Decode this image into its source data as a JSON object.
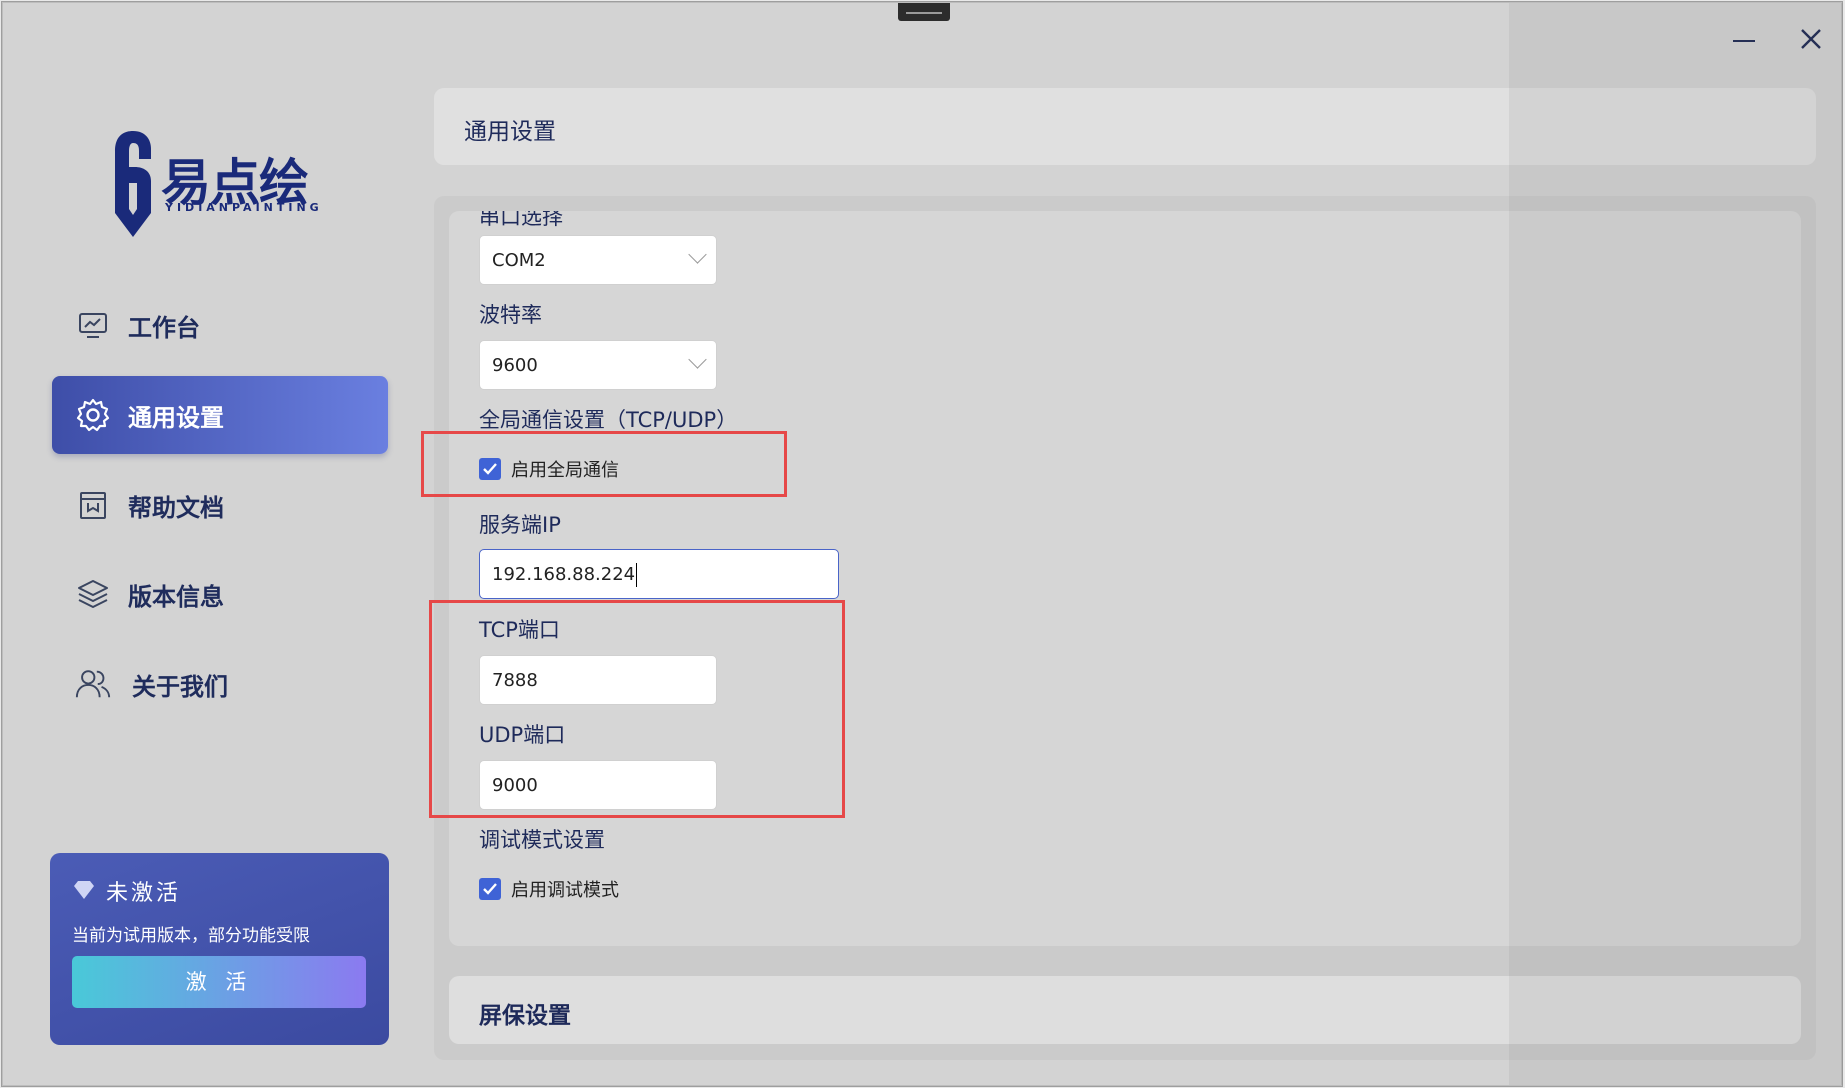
{
  "app": {
    "logo_text": "易点绘",
    "logo_sub": "YIDIANPAINTING"
  },
  "sidebar": {
    "items": [
      {
        "label": "工作台",
        "icon": "monitor-icon",
        "active": false
      },
      {
        "label": "通用设置",
        "icon": "gear-icon",
        "active": true
      },
      {
        "label": "帮助文档",
        "icon": "document-icon",
        "active": false
      },
      {
        "label": "版本信息",
        "icon": "layers-icon",
        "active": false
      },
      {
        "label": "关于我们",
        "icon": "users-icon",
        "active": false
      }
    ]
  },
  "promo": {
    "title": "未激活",
    "description": "当前为试用版本，部分功能受限",
    "button_label": "激 活"
  },
  "header": {
    "title": "通用设置"
  },
  "settings": {
    "serial_label_partial": "串口选择",
    "serial_port": "COM2",
    "baud_label": "波特率",
    "baud_rate": "9600",
    "global_comm_label": "全局通信设置（TCP/UDP）",
    "global_comm_checkbox": "启用全局通信",
    "global_comm_enabled": true,
    "server_ip_label": "服务端IP",
    "server_ip": "192.168.88.224",
    "tcp_label": "TCP端口",
    "tcp_port": "7888",
    "udp_label": "UDP端口",
    "udp_port": "9000",
    "debug_label": "调试模式设置",
    "debug_checkbox": "启用调试模式",
    "debug_enabled": true
  },
  "screensaver": {
    "title": "屏保设置"
  },
  "colors": {
    "accent": "#3f63d6",
    "active_nav_start": "#3e4ea8",
    "active_nav_end": "#6a7fe0",
    "highlight_box": "#e64848",
    "text": "#1e2a5a"
  }
}
